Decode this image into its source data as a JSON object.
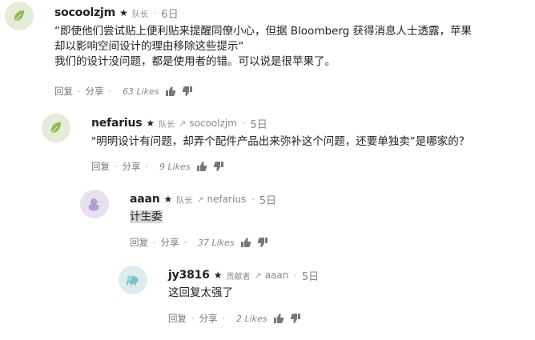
{
  "comments": [
    {
      "username": "socoolzjm",
      "star": "★",
      "role": "队长",
      "reply_to": "",
      "time": "6日",
      "lines": [
        "“即使他们尝试贴上便利贴来提醒同僚小心，但据 Bloomberg 获得消息人士透露，苹果",
        "却以影响空间设计的理由移除这些提示“",
        "我们的设计没问题，都是使用者的错。可以说是很苹果了。"
      ],
      "reply_label": "回复",
      "share_label": "分享",
      "likes": "63 Likes",
      "avatar_icon": "leaf-icon",
      "avatar_bg": "#e5ecd7"
    },
    {
      "username": "nefarius",
      "star": "★",
      "role": "队长",
      "reply_to": "socoolzjm",
      "time": "5日",
      "lines": [
        "\"明明设计有问题，却弄个配件产品出来弥补这个问题，还要单独卖“是哪家的？"
      ],
      "reply_label": "回复",
      "share_label": "分享",
      "likes": "9 Likes",
      "avatar_icon": "leaf-icon",
      "avatar_bg": "#e5ecd7"
    },
    {
      "username": "aaan",
      "star": "★",
      "role": "队长",
      "reply_to": "nefarius",
      "time": "5日",
      "lines": [
        "计生委"
      ],
      "reply_label": "回复",
      "share_label": "分享",
      "likes": "37 Likes",
      "avatar_icon": "duck-icon",
      "avatar_bg": "#e8e0ef"
    },
    {
      "username": "jy3816",
      "star": "★",
      "role": "贡献者",
      "reply_to": "aaan",
      "time": "5日",
      "lines": [
        "这回复太强了"
      ],
      "reply_label": "回复",
      "share_label": "分享",
      "likes": "2 Likes",
      "avatar_icon": "elephant-icon",
      "avatar_bg": "#dcecef"
    }
  ],
  "separator": "·",
  "reply_arrow": "↗"
}
